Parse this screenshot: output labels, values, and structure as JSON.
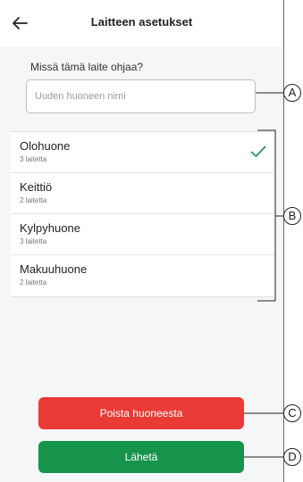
{
  "header": {
    "title": "Laitteen asetukset",
    "back_icon": "arrow-left-icon"
  },
  "room_prompt": "Missä tämä laite ohjaa?",
  "new_room_input": {
    "placeholder": "Uuden huoneen nimi",
    "value": ""
  },
  "rooms": [
    {
      "name": "Olohuone",
      "count": "3 laitetta",
      "selected": true
    },
    {
      "name": "Keittiö",
      "count": "2 laitetta",
      "selected": false
    },
    {
      "name": "Kylpyhuone",
      "count": "3 laitetta",
      "selected": false
    },
    {
      "name": "Makuuhuone",
      "count": "2 laitetta",
      "selected": false
    }
  ],
  "buttons": {
    "remove_label": "Poista huoneesta",
    "submit_label": "Lähetä"
  },
  "callouts": {
    "a": "A",
    "b": "B",
    "c": "C",
    "d": "D"
  },
  "colors": {
    "remove": "#ea3a35",
    "submit": "#16944c",
    "check": "#1e9b4f"
  }
}
